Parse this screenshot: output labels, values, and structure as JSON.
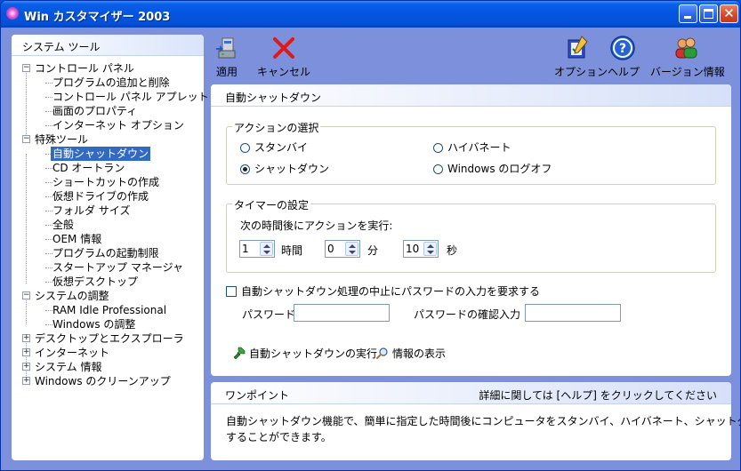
{
  "window": {
    "title": "Win カスタマイザー 2003"
  },
  "sidebar": {
    "header": "システム ツール",
    "tree": [
      {
        "label": "コントロール パネル",
        "level": 0,
        "expander": "−"
      },
      {
        "label": "プログラムの追加と削除",
        "level": 1
      },
      {
        "label": "コントロール パネル アプレット",
        "level": 1
      },
      {
        "label": "画面のプロパティ",
        "level": 1
      },
      {
        "label": "インターネット オプション",
        "level": 1
      },
      {
        "label": "特殊ツール",
        "level": 0,
        "expander": "−"
      },
      {
        "label": "自動シャットダウン",
        "level": 1,
        "selected": true
      },
      {
        "label": "CD オートラン",
        "level": 1
      },
      {
        "label": "ショートカットの作成",
        "level": 1
      },
      {
        "label": "仮想ドライブの作成",
        "level": 1
      },
      {
        "label": "フォルダ サイズ",
        "level": 1
      },
      {
        "label": "全般",
        "level": 1
      },
      {
        "label": "OEM 情報",
        "level": 1
      },
      {
        "label": "プログラムの起動制限",
        "level": 1
      },
      {
        "label": "スタートアップ マネージャ",
        "level": 1
      },
      {
        "label": "仮想デスクトップ",
        "level": 1
      },
      {
        "label": "システムの調整",
        "level": 0,
        "expander": "−"
      },
      {
        "label": "RAM Idle Professional",
        "level": 1
      },
      {
        "label": "Windows の調整",
        "level": 1
      },
      {
        "label": "デスクトップとエクスプローラ",
        "level": 0,
        "expander": "+"
      },
      {
        "label": "インターネット",
        "level": 0,
        "expander": "+"
      },
      {
        "label": "システム 情報",
        "level": 0,
        "expander": "+"
      },
      {
        "label": "Windows のクリーンアップ",
        "level": 0,
        "expander": "+"
      }
    ]
  },
  "toolbar": {
    "apply": "適用",
    "cancel": "キャンセル",
    "options": "オプション",
    "help": "ヘルプ",
    "version": "バージョン情報"
  },
  "main": {
    "title": "自動シャットダウン",
    "action_group": {
      "label": "アクションの選択",
      "options": [
        "スタンバイ",
        "ハイバネート",
        "シャットダウン",
        "Windows のログオフ"
      ],
      "selected": "シャットダウン"
    },
    "timer_group": {
      "label": "タイマーの設定",
      "instruction": "次の時間後にアクションを実行:",
      "hours": "1",
      "hours_unit": "時間",
      "minutes": "0",
      "minutes_unit": "分",
      "seconds": "10",
      "seconds_unit": "秒"
    },
    "password_checkbox": "自動シャットダウン処理の中止にパスワードの入力を要求する",
    "password_checked": false,
    "password_label": "パスワード",
    "password_value": "",
    "confirm_label": "パスワードの確認入力",
    "confirm_value": "",
    "run_link": "自動シャットダウンの実行",
    "info_link": "情報の表示"
  },
  "tip": {
    "title": "ワンポイント",
    "help_hint": "詳細に関しては [ヘルプ] をクリックしてください",
    "body_line1": "自動シャットダウン機能で、簡単に指定した時間後にコンピュータをスタンバイ、ハイバネート、シャットダウン",
    "body_line2": "することができます。"
  }
}
